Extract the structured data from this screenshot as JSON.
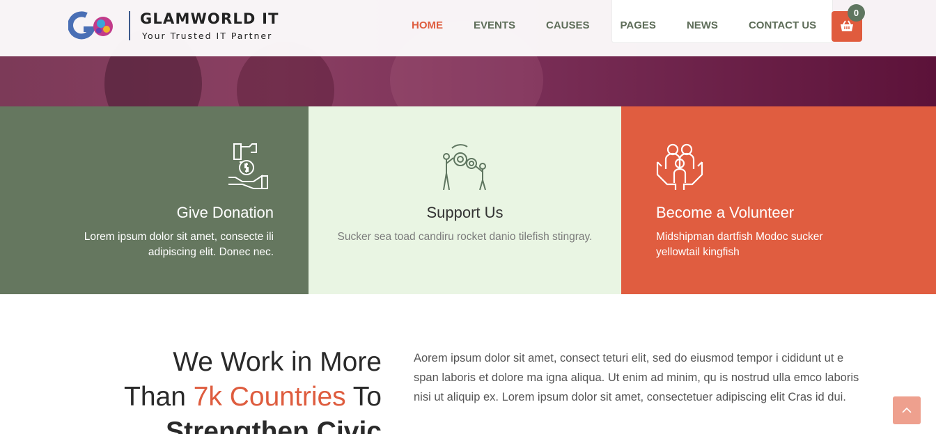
{
  "brand": {
    "name": "GLAMWORLD IT",
    "tagline": "Your Trusted IT Partner"
  },
  "nav": {
    "items": [
      "HOME",
      "EVENTS",
      "CAUSES",
      "PAGES",
      "NEWS",
      "CONTACT US"
    ],
    "active": "HOME"
  },
  "cart": {
    "count": "0",
    "icon": "basket-icon"
  },
  "features": [
    {
      "title": "Give Donation",
      "text": "Lorem ipsum dolor sit amet, consecte ili adipiscing elit. Donec nec.",
      "icon": "donation-hand-icon",
      "bg": "#65775f"
    },
    {
      "title": "Support Us",
      "text": "Sucker sea toad candiru rocket danio tilefish stingray.",
      "icon": "gears-people-icon",
      "bg": "#e9f5e3"
    },
    {
      "title": "Become a Volunteer",
      "text": "Midshipman dartfish Modoc sucker yellowtail kingfish",
      "icon": "family-hands-icon",
      "bg": "#e05d40"
    }
  ],
  "about": {
    "heading_line1": "We Work in More",
    "heading_line2_a": "Than ",
    "heading_line2_accent": "7k Countries",
    "heading_line2_b": " To",
    "heading_line3": "Strengthen Civic",
    "body": "Aorem ipsum dolor sit amet, consect teturi elit, sed do eiusmod tempor i cididunt ut e span laboris et dolore ma igna aliqua. Ut enim ad minim, qu is nostrud ulla emco laboris nisi ut aliquip ex. Lorem ipsum dolor sit amet, consectetuer adipiscing elit Cras id dui."
  },
  "colors": {
    "accent": "#de5c3e",
    "green": "#65775f",
    "mint": "#e9f5e3"
  },
  "scroll_top_icon": "chevron-up-icon"
}
